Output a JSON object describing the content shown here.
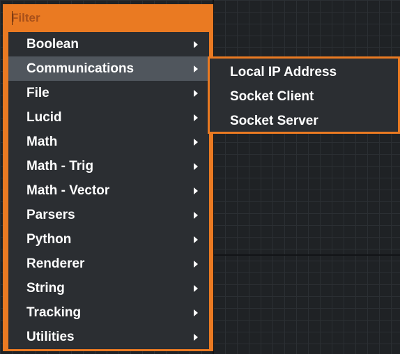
{
  "filter": {
    "placeholder": "Filter"
  },
  "menu": {
    "items": [
      {
        "label": "Boolean"
      },
      {
        "label": "Communications"
      },
      {
        "label": "File"
      },
      {
        "label": "Lucid"
      },
      {
        "label": "Math"
      },
      {
        "label": "Math - Trig"
      },
      {
        "label": "Math - Vector"
      },
      {
        "label": "Parsers"
      },
      {
        "label": "Python"
      },
      {
        "label": "Renderer"
      },
      {
        "label": "String"
      },
      {
        "label": "Tracking"
      },
      {
        "label": "Utilities"
      }
    ],
    "active_item": "Communications"
  },
  "submenu": {
    "items": [
      {
        "label": "Local IP Address"
      },
      {
        "label": "Socket Client"
      },
      {
        "label": "Socket Server"
      }
    ]
  },
  "colors": {
    "accent": "#ea7a22",
    "menu_bg": "#2b2e32",
    "highlight": "#50565d",
    "canvas_bg": "#1f2225"
  },
  "icons": {
    "submenu_arrow": "chevron-right-icon"
  }
}
